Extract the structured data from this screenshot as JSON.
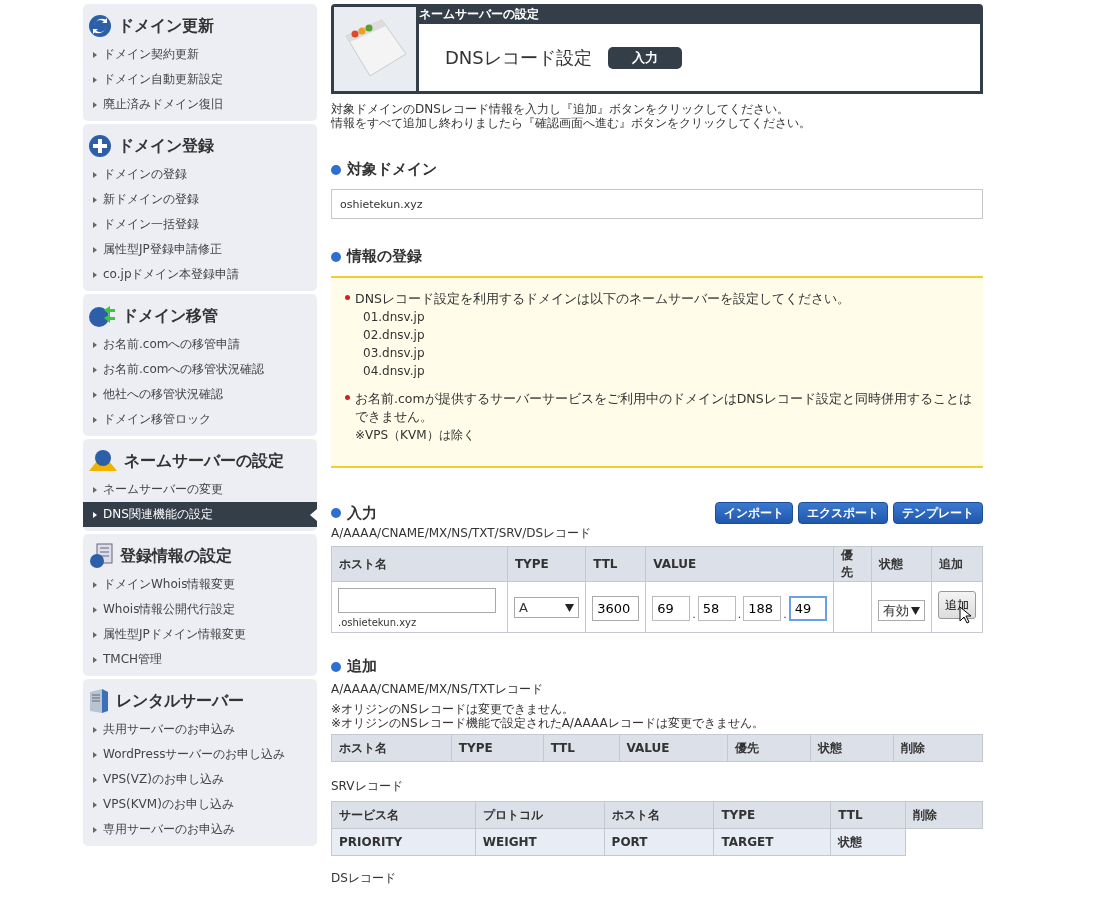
{
  "sidebar": {
    "sections": [
      {
        "title": "ドメイン更新",
        "items": [
          {
            "label": "ドメイン契約更新",
            "selected": false
          },
          {
            "label": "ドメイン自動更新設定",
            "selected": false
          },
          {
            "label": "廃止済みドメイン復旧",
            "selected": false
          }
        ]
      },
      {
        "title": "ドメイン登録",
        "items": [
          {
            "label": "ドメインの登録",
            "selected": false
          },
          {
            "label": "新ドメインの登録",
            "selected": false
          },
          {
            "label": "ドメイン一括登録",
            "selected": false
          },
          {
            "label": "属性型JP登録申請修正",
            "selected": false
          },
          {
            "label": "co.jpドメイン本登録申請",
            "selected": false
          }
        ]
      },
      {
        "title": "ドメイン移管",
        "items": [
          {
            "label": "お名前.comへの移管申請",
            "selected": false
          },
          {
            "label": "お名前.comへの移管状況確認",
            "selected": false
          },
          {
            "label": "他社への移管状況確認",
            "selected": false
          },
          {
            "label": "ドメイン移管ロック",
            "selected": false
          }
        ]
      },
      {
        "title": "ネームサーバーの設定",
        "items": [
          {
            "label": "ネームサーバーの変更",
            "selected": false
          },
          {
            "label": "DNS関連機能の設定",
            "selected": true
          }
        ]
      },
      {
        "title": "登録情報の設定",
        "items": [
          {
            "label": "ドメインWhois情報変更",
            "selected": false
          },
          {
            "label": "Whois情報公開代行設定",
            "selected": false
          },
          {
            "label": "属性型JPドメイン情報変更",
            "selected": false
          },
          {
            "label": "TMCH管理",
            "selected": false
          }
        ]
      },
      {
        "title": "レンタルサーバー",
        "items": [
          {
            "label": "共用サーバーのお申込み",
            "selected": false
          },
          {
            "label": "WordPressサーバーのお申し込み",
            "selected": false
          },
          {
            "label": "VPS(VZ)のお申し込み",
            "selected": false
          },
          {
            "label": "VPS(KVM)のお申し込み",
            "selected": false
          },
          {
            "label": "専用サーバーのお申込み",
            "selected": false
          }
        ]
      }
    ]
  },
  "header": {
    "category": "ネームサーバーの設定",
    "title": "DNSレコード設定",
    "badge": "入力"
  },
  "instructions": [
    "対象ドメインのDNSレコード情報を入力し『追加』ボタンをクリックしてください。",
    "情報をすべて追加し終わりましたら『確認画面へ進む』ボタンをクリックしてください。"
  ],
  "target_domain": {
    "heading": "対象ドメイン",
    "value": "oshietekun.xyz"
  },
  "info": {
    "heading": "情報の登録",
    "notes": [
      {
        "text": "DNSレコード設定を利用するドメインは以下のネームサーバーを設定してください。",
        "lines": [
          "01.dnsv.jp",
          "02.dnsv.jp",
          "03.dnsv.jp",
          "04.dnsv.jp"
        ]
      },
      {
        "text": "お名前.comが提供するサーバーサービスをご利用中のドメインはDNSレコード設定と同時併用することはできません。",
        "lines": [
          "※VPS（KVM）は除く"
        ]
      }
    ]
  },
  "input": {
    "heading": "入力",
    "buttons": [
      "インポート",
      "エクスポート",
      "テンプレート"
    ],
    "record_types": "A/AAAA/CNAME/MX/NS/TXT/SRV/DSレコード",
    "columns": [
      "ホスト名",
      "TYPE",
      "TTL",
      "VALUE",
      "優先",
      "状態",
      "追加"
    ],
    "row": {
      "host_suffix": ".oshietekun.xyz",
      "type": "A",
      "ttl": "3600",
      "separator": ".",
      "octets": [
        {
          "value": "69",
          "focused": false
        },
        {
          "value": "58",
          "focused": false
        },
        {
          "value": "188",
          "focused": false
        },
        {
          "value": "49",
          "focused": true
        }
      ],
      "status": "有効",
      "add_button": "追加"
    }
  },
  "added": {
    "heading": "追加",
    "record_types": "A/AAAA/CNAME/MX/NS/TXTレコード",
    "notes": [
      "※オリジンのNSレコードは変更できません。",
      "※オリジンのNSレコード機能で設定されたA/AAAAレコードは変更できません。"
    ],
    "columns": [
      "ホスト名",
      "TYPE",
      "TTL",
      "VALUE",
      "優先",
      "状態",
      "削除"
    ]
  },
  "srv": {
    "label": "SRVレコード",
    "header_row": [
      "サービス名",
      "プロトコル",
      "ホスト名",
      "TYPE",
      "TTL",
      "削除"
    ],
    "second_row": [
      "PRIORITY",
      "WEIGHT",
      "PORT",
      "TARGET",
      "状態"
    ]
  },
  "ds": {
    "label": "DSレコード"
  }
}
